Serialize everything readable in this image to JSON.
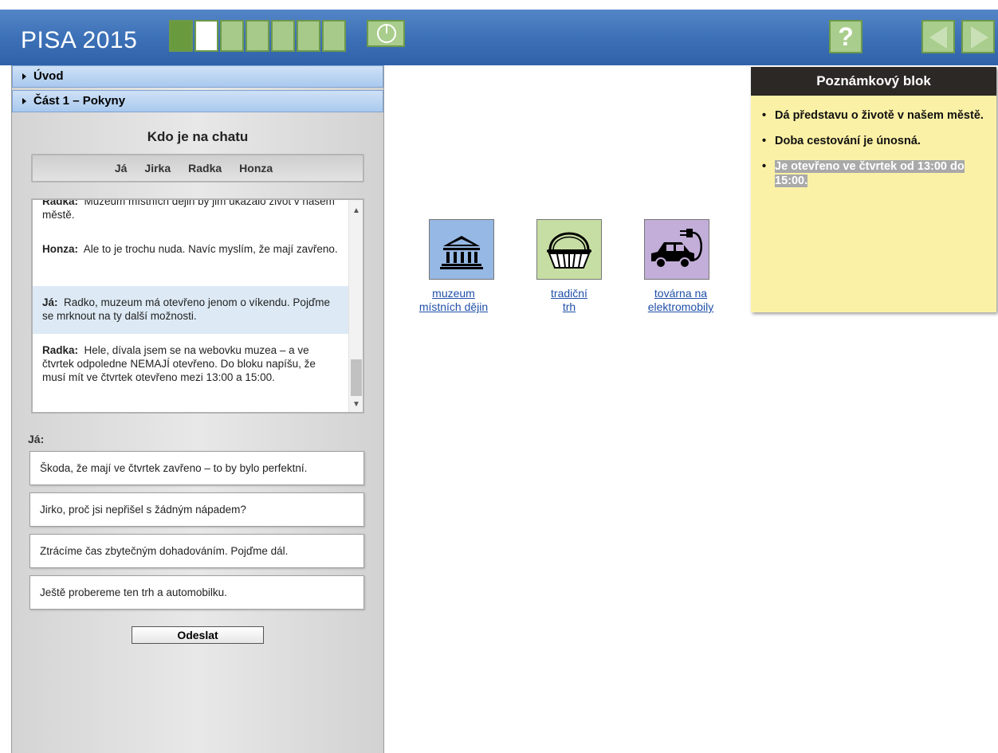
{
  "app": {
    "title": "PISA 2015"
  },
  "progress": {
    "total": 7,
    "completed": 1,
    "current": 2
  },
  "toolbar": {
    "help_label": "?"
  },
  "accordion": [
    {
      "label": "Úvod"
    },
    {
      "label": "Část 1 – Pokyny"
    }
  ],
  "chat": {
    "title": "Kdo je na chatu",
    "participants": [
      "Já",
      "Jirka",
      "Radka",
      "Honza"
    ],
    "messages": [
      {
        "speaker": "Radka:",
        "text": "Muzeum místních dějin by jim ukázalo život v našem městě."
      },
      {
        "speaker": "Honza:",
        "text": "Ale to je trochu nuda. Navíc myslím, že mají zavřeno."
      },
      {
        "speaker": "Já:",
        "text": "Radko, muzeum má otevřeno jenom o víkendu. Pojďme se mrknout na ty další možnosti."
      },
      {
        "speaker": "Radka:",
        "text": "Hele, dívala jsem se na webovku muzea – a ve čtvrtek odpoledne NEMAJÍ otevřeno. Do bloku napíšu, že musí mít ve čtvrtek otevřeno mezi 13:00 a 15:00."
      }
    ],
    "reply_label": "Já:",
    "options": [
      "Škoda, že mají ve čtvrtek zavřeno – to by bylo perfektní.",
      "Jirko, proč jsi nepřišel s žádným nápadem?",
      "Ztrácíme čas zbytečným dohadováním. Pojďme dál.",
      "Ještě probereme ten trh a automobilku."
    ],
    "send_label": "Odeslat"
  },
  "places": [
    {
      "label_line1": "muzeum",
      "label_line2": "místních dějin",
      "icon": "museum-icon",
      "color": "#96b8e4"
    },
    {
      "label_line1": "tradiční",
      "label_line2": "trh",
      "icon": "basket-icon",
      "color": "#c6dea4"
    },
    {
      "label_line1": "továrna na",
      "label_line2": "elektromobily",
      "icon": "electric-car-icon",
      "color": "#c2aed8"
    }
  ],
  "notepad": {
    "title": "Poznámkový blok",
    "notes": [
      "Dá představu o životě v našem městě.",
      "Doba cestování je únosná.",
      "Je otevřeno ve čtvrtek od 13:00 do 15:00."
    ]
  }
}
